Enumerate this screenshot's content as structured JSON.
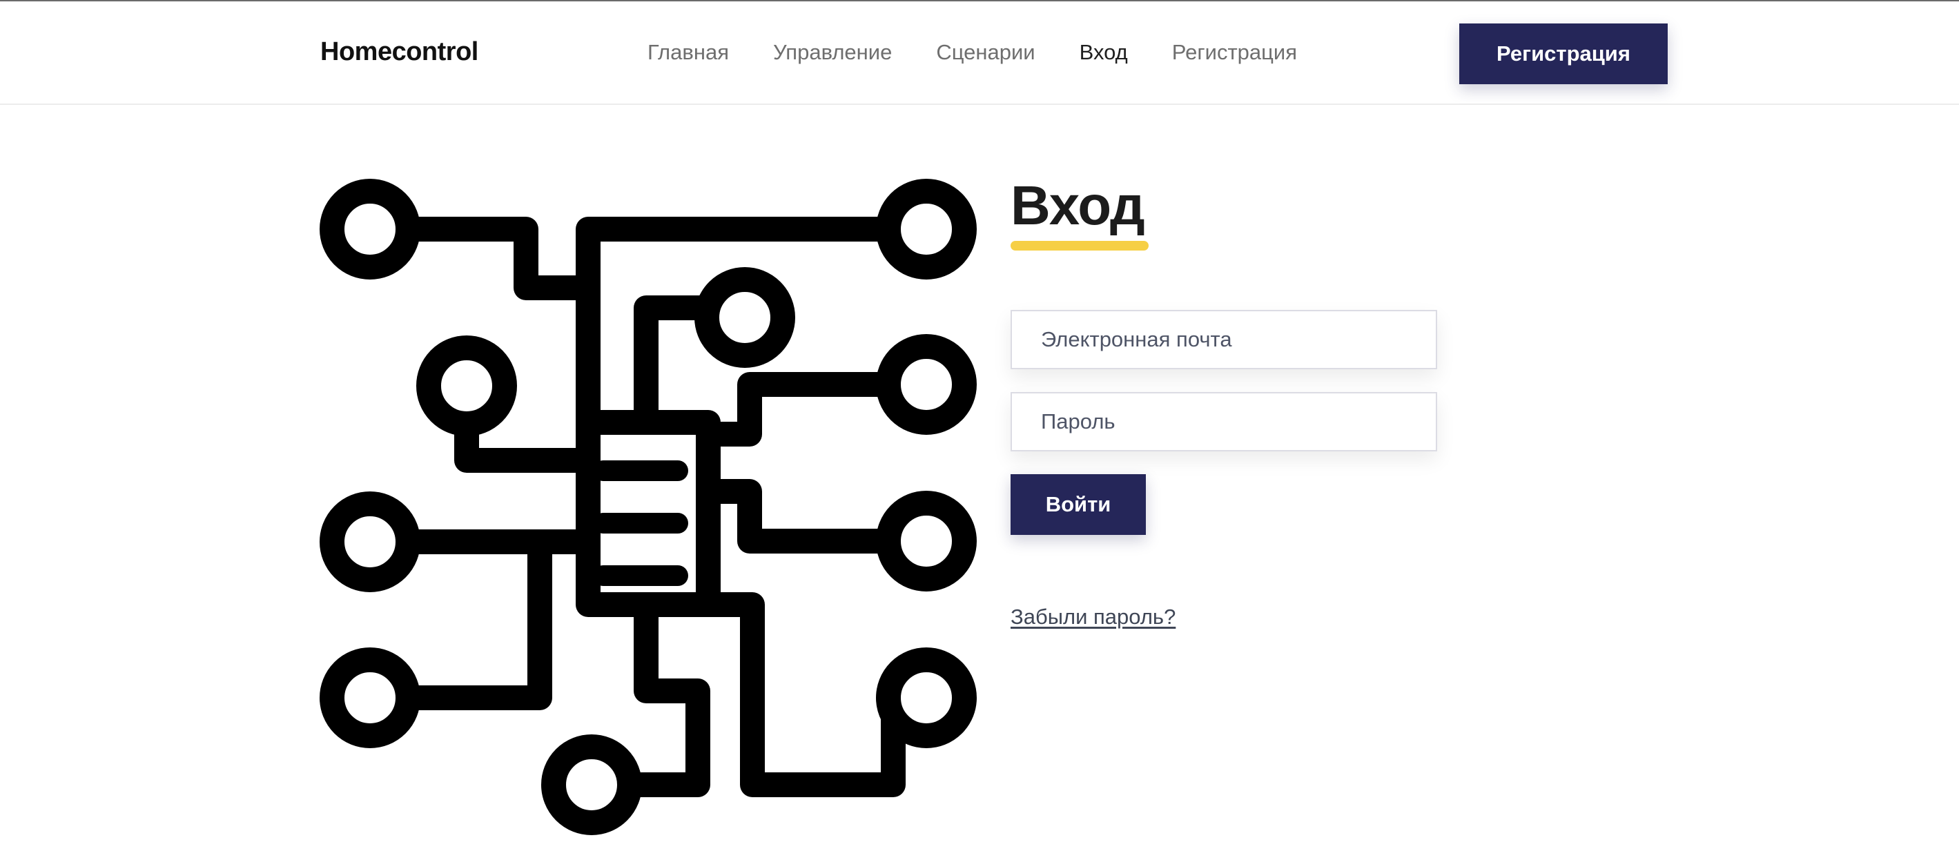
{
  "header": {
    "brand": "Homecontrol",
    "nav": [
      {
        "label": "Главная"
      },
      {
        "label": "Управление"
      },
      {
        "label": "Сценарии"
      },
      {
        "label": "Вход"
      },
      {
        "label": "Регистрация"
      }
    ],
    "register_button": "Регистрация"
  },
  "login": {
    "title": "Вход",
    "email_placeholder": "Электронная почта",
    "password_placeholder": "Пароль",
    "submit_label": "Войти",
    "forgot_link": "Забыли пароль?"
  },
  "colors": {
    "accent": "#252659",
    "underline": "#f6cf45"
  },
  "illustration": {
    "icon": "circuit-board-icon"
  }
}
